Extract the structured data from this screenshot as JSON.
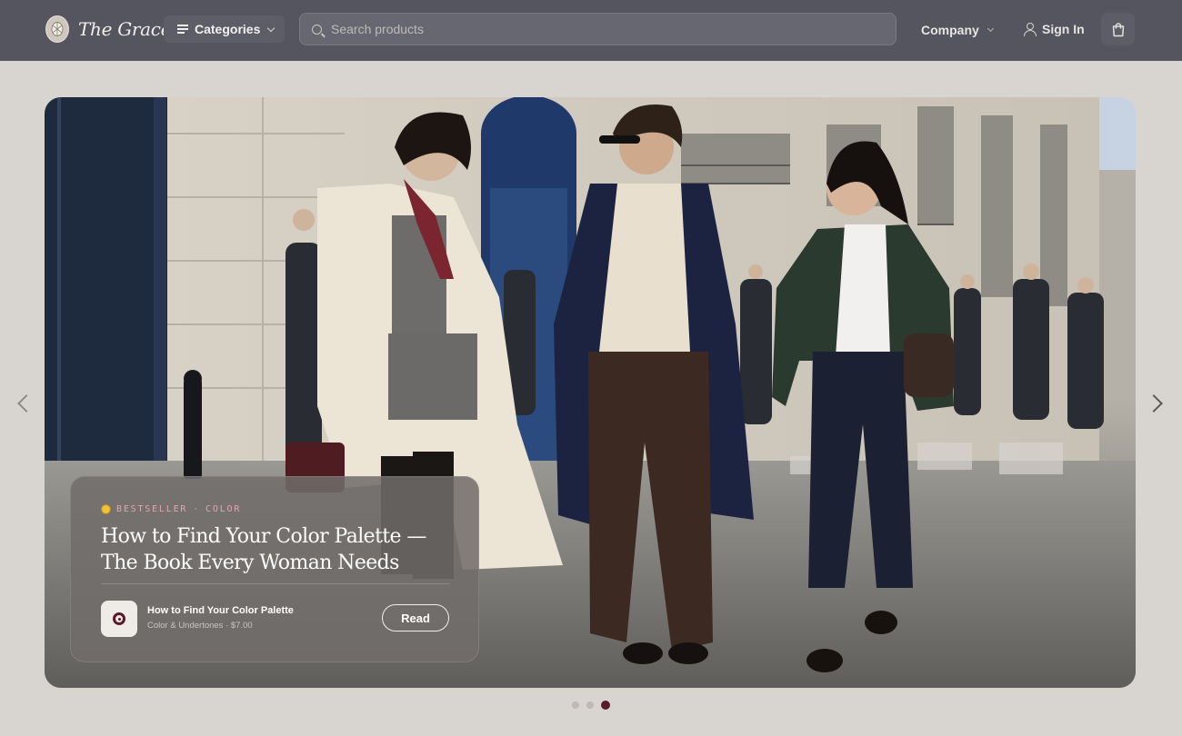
{
  "header": {
    "brand": "The Grace",
    "categories_label": "Categories",
    "search_placeholder": "Search products",
    "company_label": "Company",
    "signin_label": "Sign In"
  },
  "hero": {
    "image_icon": "street-fashion-photo",
    "card": {
      "badge_icon": "medal-icon",
      "eyebrow_primary": "BESTSELLER",
      "eyebrow_separator": "·",
      "eyebrow_secondary": "COLOR",
      "title": "How to Find Your Color Palette — The Book Every Woman Needs",
      "product_name": "How to Find Your Color Palette",
      "product_meta": "Color & Undertones · $7.00",
      "read_label": "Read"
    },
    "slides_total": 3,
    "active_slide": 3
  },
  "colors": {
    "header_bg": "#55555f",
    "page_bg": "#d8d4d0",
    "accent": "#5a1a27",
    "eyebrow": "#e3a5b2"
  }
}
